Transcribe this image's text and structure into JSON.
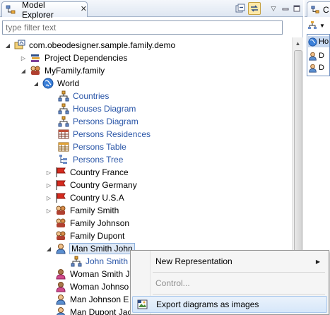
{
  "view": {
    "title": "Model Explorer",
    "filter_placeholder": "type filter text"
  },
  "tree": {
    "project": "com.obeodesigner.sample.family.demo",
    "dependencies": "Project Dependencies",
    "model": "MyFamily.family",
    "world": "World",
    "representations": [
      {
        "label": "Countries",
        "icon": "diagram-icon"
      },
      {
        "label": "Houses Diagram",
        "icon": "diagram-icon"
      },
      {
        "label": "Persons Diagram",
        "icon": "diagram-icon"
      },
      {
        "label": "Persons Residences",
        "icon": "cross-table-icon"
      },
      {
        "label": "Persons Table",
        "icon": "table-icon"
      },
      {
        "label": "Persons Tree",
        "icon": "tree-icon"
      }
    ],
    "countries": [
      "Country France",
      "Country Germany",
      "Country U.S.A"
    ],
    "families": [
      "Family Smith",
      "Family Johnson",
      "Family Dupont"
    ],
    "selected_person": "Man Smith John",
    "child_representation": "John Smith",
    "persons_after": [
      "Woman Smith J",
      "Woman Johnso",
      "Man Johnson E",
      "Man Dupont Jacques"
    ]
  },
  "context_menu": {
    "new_representation": "New Representation",
    "control": "Control...",
    "export_diagrams": "Export diagrams as images"
  },
  "right_view": {
    "tab_label": "C",
    "items": [
      "Ho",
      "D",
      "D"
    ]
  },
  "colors": {
    "selection": "#dde8f6",
    "representation_text": "#2a56a8",
    "menu_highlight": "#d6e7fa"
  }
}
